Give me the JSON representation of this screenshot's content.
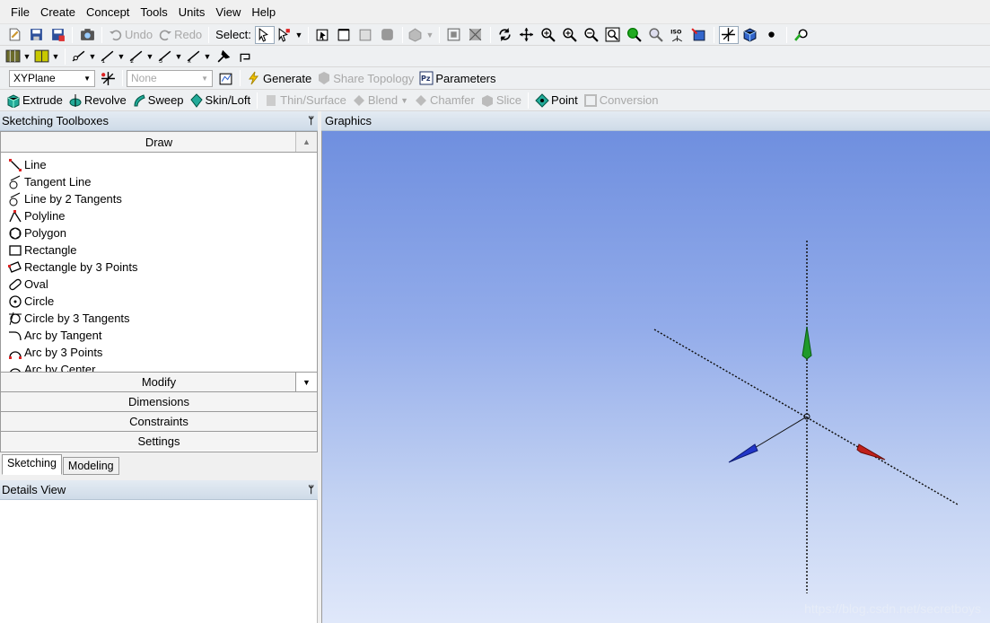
{
  "menu": [
    "File",
    "Create",
    "Concept",
    "Tools",
    "Units",
    "View",
    "Help"
  ],
  "toolbar1": {
    "undo": "Undo",
    "redo": "Redo",
    "select": "Select:"
  },
  "toolbar3": {
    "plane": "XYPlane",
    "sketch": "None",
    "generate": "Generate",
    "share_topology": "Share Topology",
    "parameters": "Parameters"
  },
  "toolbar4": {
    "extrude": "Extrude",
    "revolve": "Revolve",
    "sweep": "Sweep",
    "skin_loft": "Skin/Loft",
    "thin_surface": "Thin/Surface",
    "blend": "Blend",
    "chamfer": "Chamfer",
    "slice": "Slice",
    "point": "Point",
    "conversion": "Conversion"
  },
  "sketching_toolboxes": {
    "title": "Sketching Toolboxes",
    "draw_header": "Draw",
    "draw_items": [
      "Line",
      "Tangent Line",
      "Line by 2 Tangents",
      "Polyline",
      "Polygon",
      "Rectangle",
      "Rectangle by 3 Points",
      "Oval",
      "Circle",
      "Circle by 3 Tangents",
      "Arc by Tangent",
      "Arc by 3 Points",
      "Arc by Center"
    ],
    "sections": [
      "Modify",
      "Dimensions",
      "Constraints",
      "Settings"
    ]
  },
  "tabs": [
    "Sketching",
    "Modeling"
  ],
  "details_view": {
    "title": "Details View"
  },
  "graphics": {
    "title": "Graphics",
    "watermark": "https://blog.csdn.net/secretboys"
  },
  "colors": {
    "axis_x": "#c0201a",
    "axis_y": "#1f9a2a",
    "axis_z": "#2236c8",
    "bg_top": "#6f8fdf",
    "bg_bottom": "#e0e8fa"
  }
}
